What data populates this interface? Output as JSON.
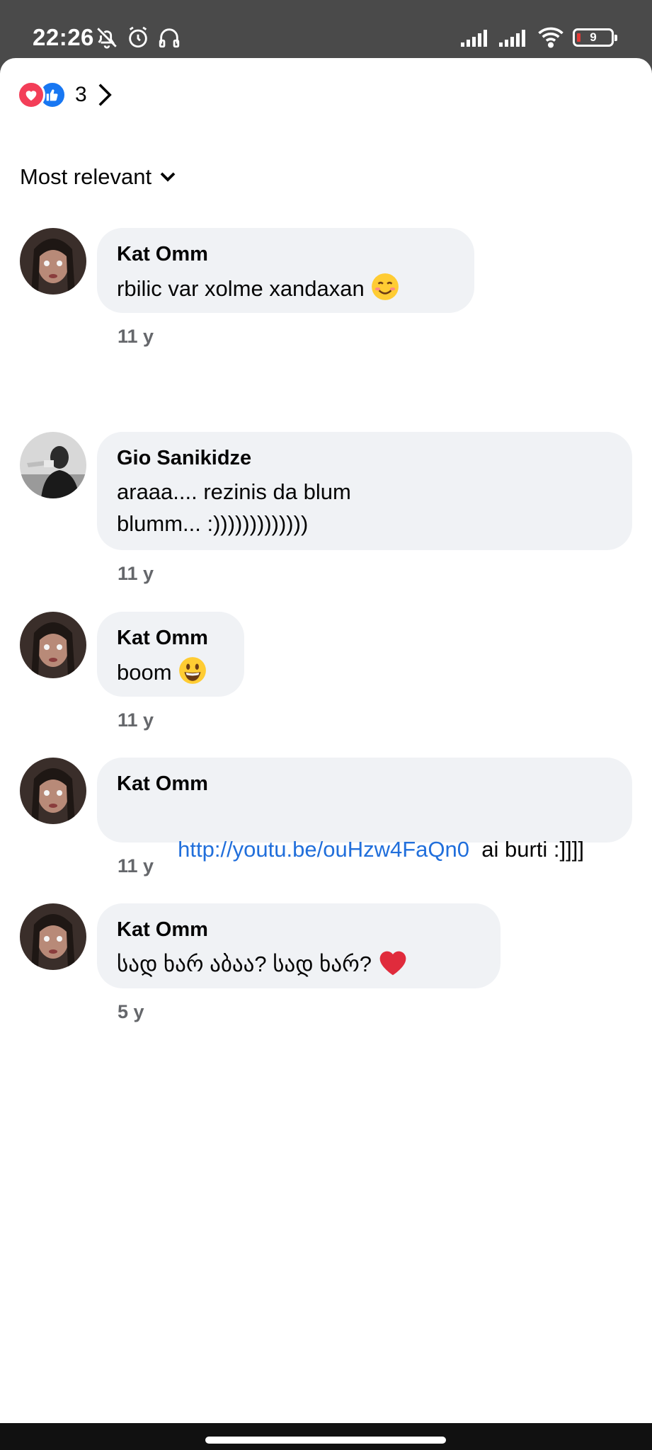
{
  "status_bar": {
    "time": "22:26",
    "battery": "9",
    "left_icons": [
      "bell-off-icon",
      "alarm-icon",
      "headphones-icon"
    ],
    "right_icons": [
      "signal-icon",
      "signal-icon",
      "wifi-icon",
      "battery-icon"
    ]
  },
  "reactions": {
    "count": "3",
    "icons": [
      "heart-icon",
      "like-icon"
    ]
  },
  "sort": {
    "label": "Most relevant"
  },
  "comments": [
    {
      "author": "Kat Omm",
      "text": "rbilic var xolme xandaxan",
      "emoji": "smiling-face-icon",
      "time": "11 y"
    },
    {
      "author": "Gio Sanikidze",
      "text_line1": "araaa....  rezinis da blum",
      "text_line2": "blumm...  :)))))))))))))",
      "time": "11 y"
    },
    {
      "author": "Kat Omm",
      "text": "boom",
      "emoji": "grinning-face-icon",
      "time": "11 y"
    },
    {
      "author": "Kat Omm",
      "link": "http://youtu.be/ouHzw4FaQn0",
      "text": "  ai burti :]]]]",
      "time": "11 y"
    },
    {
      "author": "Kat Omm",
      "text": "სად ხარ აბაა? სად ხარ?",
      "emoji": "red-heart-icon",
      "time": "5 y"
    }
  ],
  "colors": {
    "bubble": "#f0f2f5",
    "link": "#216fdb",
    "timestamp": "#65676b",
    "heart_reaction": "#f33e58",
    "like_reaction": "#1877f2"
  }
}
